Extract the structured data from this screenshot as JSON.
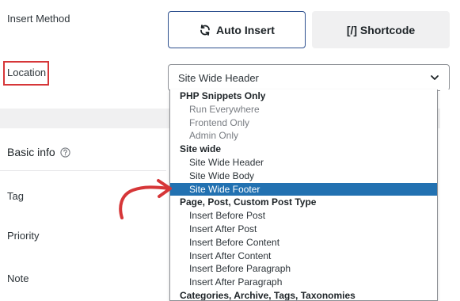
{
  "insert_method": {
    "label": "Insert Method",
    "auto_insert_label": "Auto Insert",
    "shortcode_label": "[/] Shortcode"
  },
  "location": {
    "label": "Location",
    "selected_value": "Site Wide Header"
  },
  "dropdown": {
    "groups": [
      {
        "label": "PHP Snippets Only",
        "options": [
          "Run Everywhere",
          "Frontend Only",
          "Admin Only"
        ]
      },
      {
        "label": "Site wide",
        "options": [
          "Site Wide Header",
          "Site Wide Body",
          "Site Wide Footer"
        ]
      },
      {
        "label": "Page, Post, Custom Post Type",
        "options": [
          "Insert Before Post",
          "Insert After Post",
          "Insert Before Content",
          "Insert After Content",
          "Insert Before Paragraph",
          "Insert After Paragraph"
        ]
      },
      {
        "label": "Categories, Archive, Tags, Taxonomies"
      }
    ],
    "highlighted_option": "Site Wide Footer"
  },
  "basic_info": {
    "label": "Basic info",
    "help_icon": "question-circle-icon"
  },
  "fields": {
    "tag_label": "Tag",
    "priority_label": "Priority",
    "note_label": "Note"
  },
  "annotation": {
    "color": "#d63638",
    "arrow_color": "#d63638"
  },
  "colors": {
    "accent": "#2271b1",
    "button_border": "#2c4f8e"
  }
}
